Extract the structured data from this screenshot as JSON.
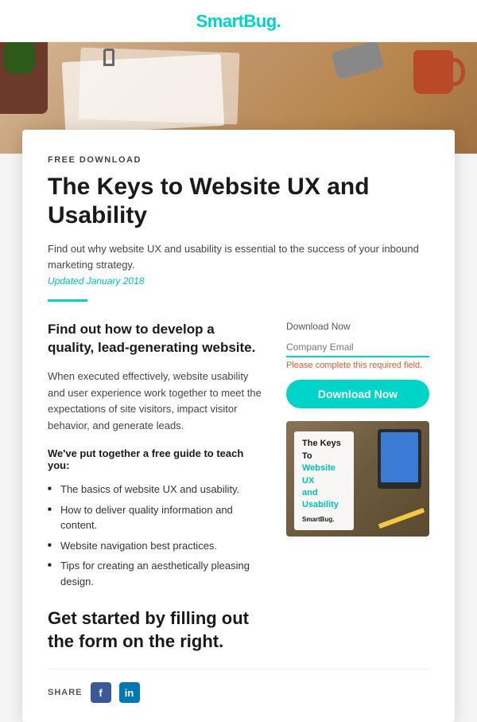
{
  "header": {
    "logo_text": "SmartBug.",
    "logo_dot": "."
  },
  "hero": {
    "alt": "Desk with papers, phone, plant and mug"
  },
  "card": {
    "free_download_label": "FREE DOWNLOAD",
    "main_title": "The Keys to Website UX and Usability",
    "subtitle": "Find out why website UX and usability is essential to the success of your inbound marketing strategy.",
    "updated_date": "Updated January 2018",
    "section_heading": "Find out how to develop a quality, lead-generating website.",
    "body_text": "When executed effectively, website usability and user experience work together to meet the expectations of site visitors, impact visitor behavior, and generate leads.",
    "bold_intro": "We've put together a free guide to teach you:",
    "bullets": [
      "The basics of website UX and usability.",
      "How to deliver quality information and content.",
      "Website navigation best practices.",
      "Tips for creating an aesthetically pleasing design."
    ],
    "cta_heading": "Get started by filling out the form on the right.",
    "share_label": "SHARE"
  },
  "form": {
    "download_now_label": "Download Now",
    "email_placeholder": "Company Email",
    "error_text": "Please complete this required field.",
    "download_btn_label": "Download Now"
  },
  "book_cover": {
    "title_line1": "The Keys To",
    "title_line2": "Website UX",
    "title_line3": "and Usability",
    "logo": "SmartBug."
  },
  "social": {
    "facebook_label": "f",
    "linkedin_label": "in"
  }
}
